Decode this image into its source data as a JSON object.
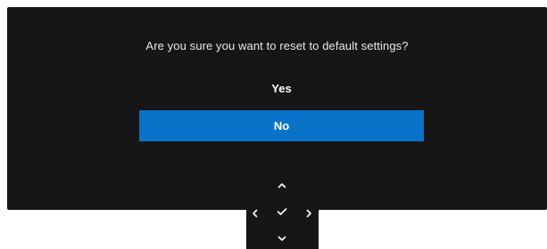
{
  "dialog": {
    "message": "Are you sure you want to reset to default settings?",
    "options": [
      {
        "label": "Yes",
        "selected": false
      },
      {
        "label": "No",
        "selected": true
      }
    ]
  },
  "nav_pad": {
    "buttons": [
      {
        "icon": "chevron-up-icon"
      },
      {
        "icon": "chevron-left-icon"
      },
      {
        "icon": "check-icon"
      },
      {
        "icon": "chevron-right-icon"
      },
      {
        "icon": "chevron-down-icon"
      }
    ]
  },
  "colors": {
    "panel_background": "#161616",
    "selected_option": "#0a72c9",
    "text": "#ffffff"
  }
}
